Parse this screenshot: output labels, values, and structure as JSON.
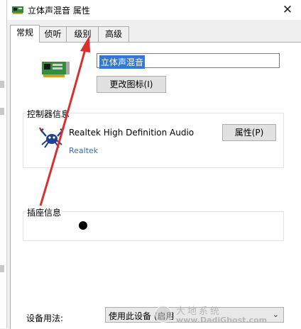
{
  "window": {
    "title": "立体声混音 属性",
    "close_symbol": "✕"
  },
  "tabs": [
    {
      "label": "常规",
      "active": true
    },
    {
      "label": "侦听",
      "active": false
    },
    {
      "label": "级别",
      "active": false
    },
    {
      "label": "高级",
      "active": false
    }
  ],
  "general": {
    "device_name_value": "立体声混音",
    "change_icon_button": "更改图标(I)",
    "controller_info_title": "控制器信息",
    "controller_name": "Realtek High Definition Audio",
    "controller_vendor": "Realtek",
    "properties_button": "属性(P)",
    "jack_info_title": "插座信息",
    "device_usage_label": "设备用法:",
    "device_usage_value": "使用此设备 (启用"
  },
  "watermark": {
    "text_cn": "大地系统",
    "text_en": "www.DadiGhost.com"
  },
  "colors": {
    "annotation_arrow": "#d9302f",
    "selection": "#3478d6",
    "link": "#3a6ea5"
  },
  "icons": [
    "sound-card-icon",
    "realtek-crab-icon",
    "chevron-down-icon",
    "close-icon"
  ]
}
